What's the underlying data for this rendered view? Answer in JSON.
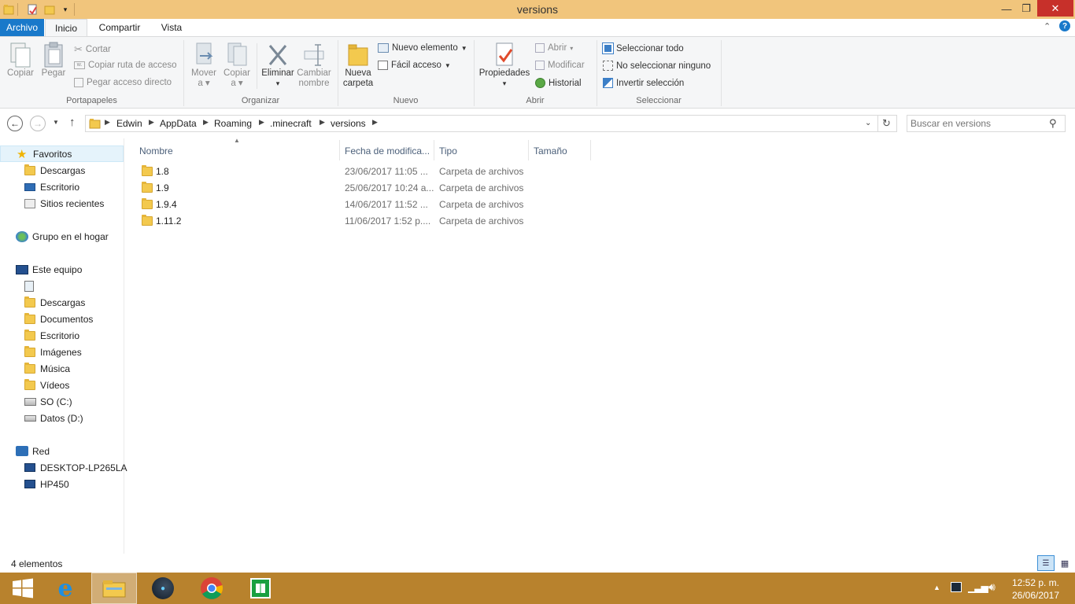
{
  "window": {
    "title": "versions",
    "minimize": "—",
    "maximize": "❐",
    "close": "✕"
  },
  "ribbon_tabs": [
    {
      "label": "Archivo",
      "active_file": true
    },
    {
      "label": "Inicio",
      "selected": true
    },
    {
      "label": "Compartir"
    },
    {
      "label": "Vista"
    }
  ],
  "ribbon": {
    "portapapeles": {
      "label": "Portapapeles",
      "copiar": "Copiar",
      "pegar": "Pegar",
      "cortar": "Cortar",
      "copiar_ruta": "Copiar ruta de acceso",
      "pegar_acceso": "Pegar acceso directo"
    },
    "organizar": {
      "label": "Organizar",
      "mover_1": "Mover",
      "mover_2": "a",
      "copiar_1": "Copiar",
      "copiar_2": "a",
      "eliminar": "Eliminar",
      "cambiar_1": "Cambiar",
      "cambiar_2": "nombre"
    },
    "nuevo": {
      "label": "Nuevo",
      "carpeta_1": "Nueva",
      "carpeta_2": "carpeta",
      "elemento": "Nuevo elemento",
      "facil": "Fácil acceso"
    },
    "abrir": {
      "label": "Abrir",
      "propiedades": "Propiedades",
      "abrir": "Abrir",
      "modificar": "Modificar",
      "historial": "Historial"
    },
    "seleccionar": {
      "label": "Seleccionar",
      "todo": "Seleccionar todo",
      "ninguno": "No seleccionar ninguno",
      "invertir": "Invertir selección"
    }
  },
  "address": {
    "crumbs": [
      "Edwin",
      "AppData",
      "Roaming",
      ".minecraft",
      "versions"
    ],
    "search_placeholder": "Buscar en versions"
  },
  "sidebar": {
    "favoritos": "Favoritos",
    "fav_items": [
      "Descargas",
      "Escritorio",
      "Sitios recientes"
    ],
    "grupo": "Grupo en el hogar",
    "equipo": "Este equipo",
    "equipo_items": [
      "Descargas",
      "Documentos",
      "Escritorio",
      "Imágenes",
      "Música",
      "Vídeos",
      "SO (C:)",
      "Datos (D:)"
    ],
    "red": "Red",
    "red_items": [
      "DESKTOP-LP265LA",
      "HP450"
    ]
  },
  "columns": {
    "name": "Nombre",
    "date": "Fecha de modifica...",
    "type": "Tipo",
    "size": "Tamaño"
  },
  "files": [
    {
      "name": "1.8",
      "date": "23/06/2017 11:05 ...",
      "type": "Carpeta de archivos"
    },
    {
      "name": "1.9",
      "date": "25/06/2017 10:24 a...",
      "type": "Carpeta de archivos"
    },
    {
      "name": "1.9.4",
      "date": "14/06/2017 11:52 ...",
      "type": "Carpeta de archivos"
    },
    {
      "name": "1.11.2",
      "date": "11/06/2017 1:52 p....",
      "type": "Carpeta de archivos"
    }
  ],
  "status": {
    "count": "4 elementos"
  },
  "taskbar": {
    "time": "12:52 p. m.",
    "date": "26/06/2017"
  },
  "colors": {
    "titlebar": "#f1c57c",
    "taskbar": "#b8822d",
    "file_tab": "#1979ca"
  }
}
